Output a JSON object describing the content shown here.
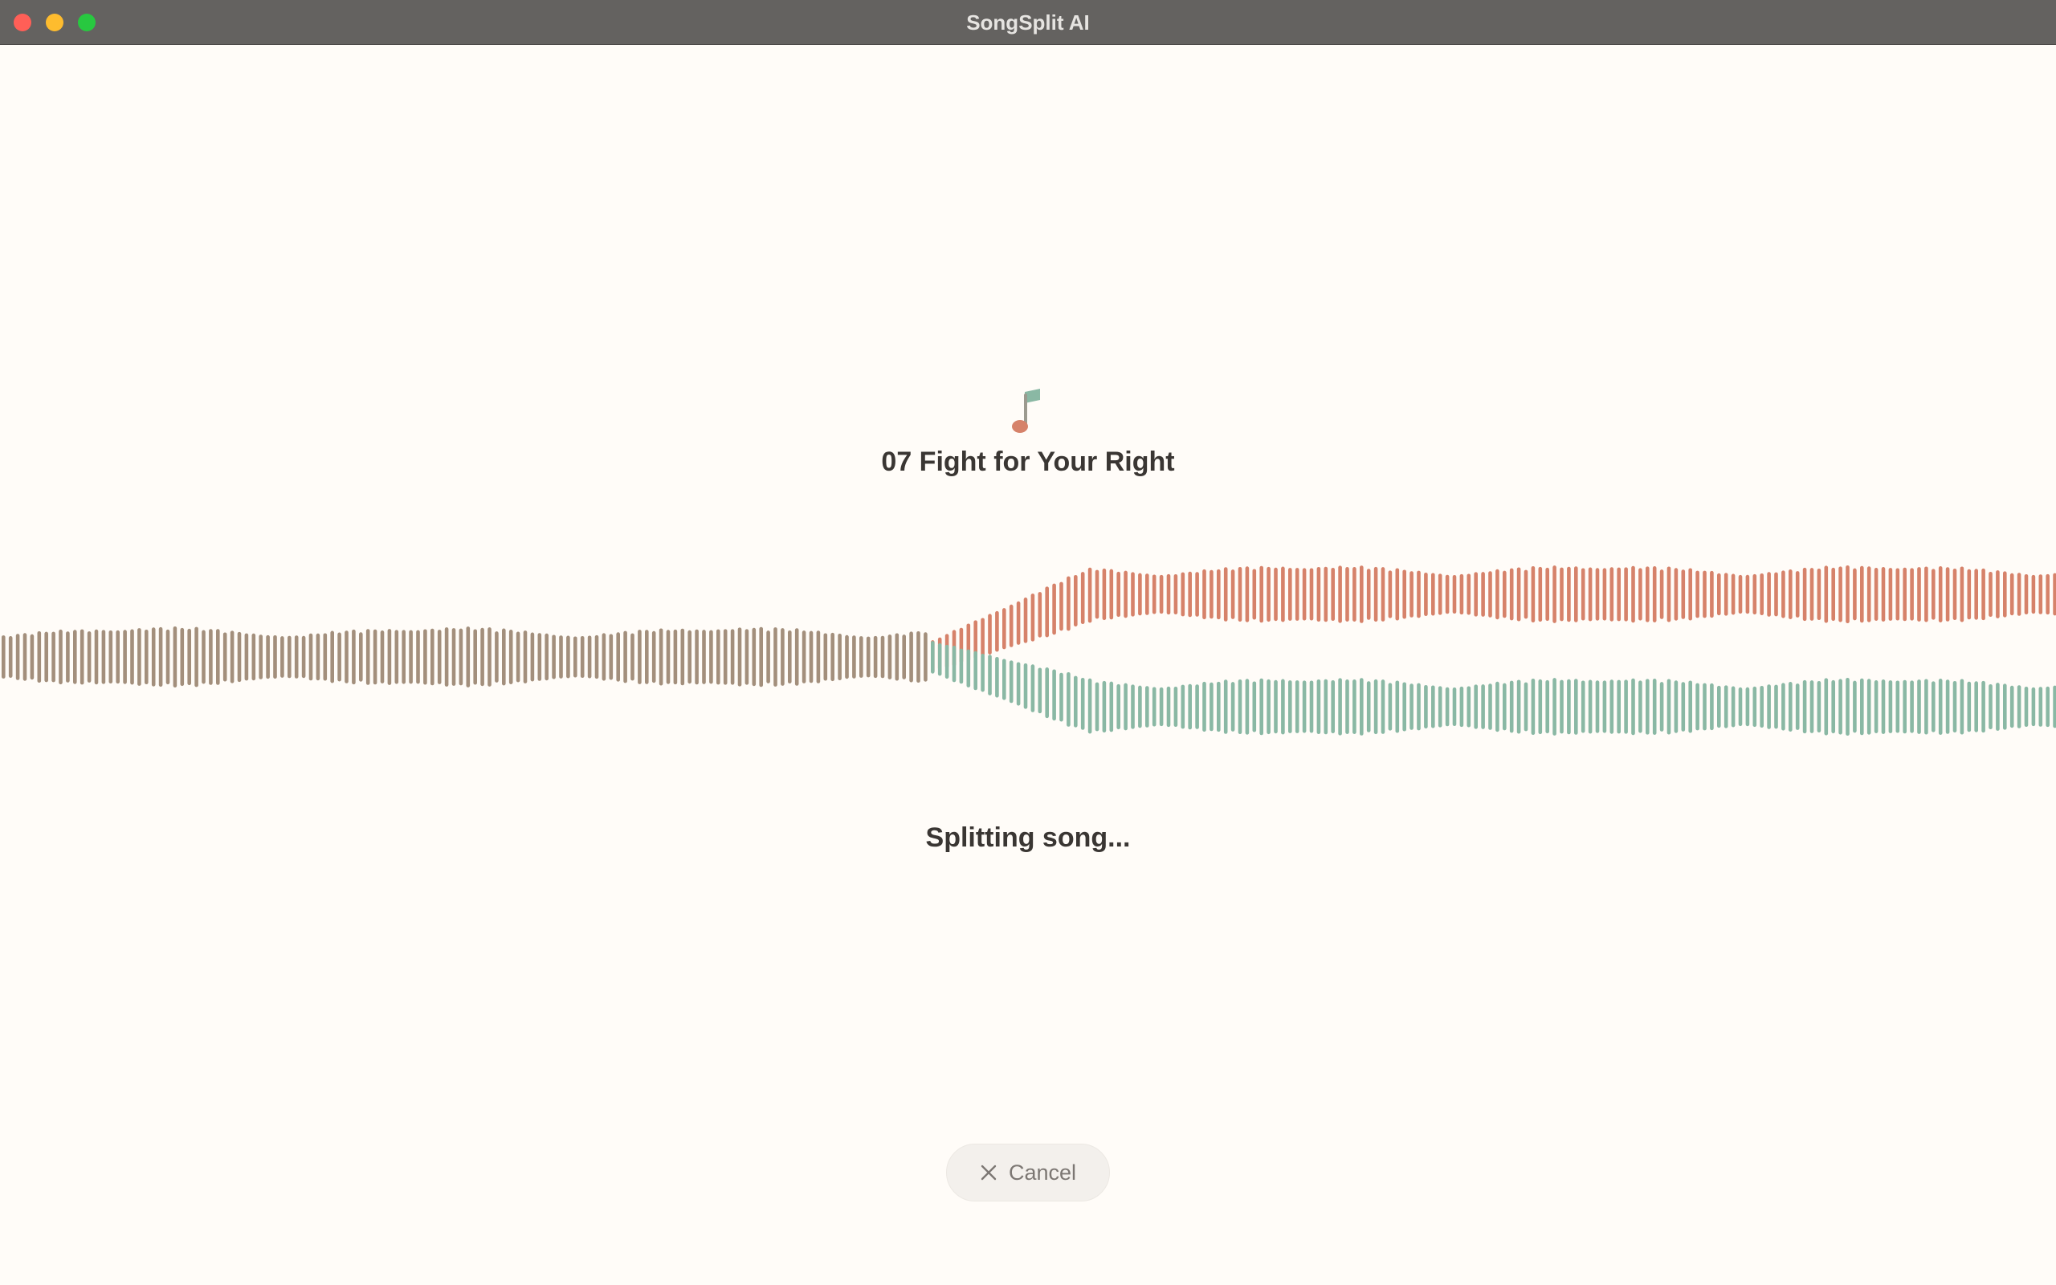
{
  "window": {
    "title": "SongSplit AI",
    "traffic_lights": {
      "close": "#ff5f57",
      "minimize": "#febc2e",
      "maximize": "#28c840"
    }
  },
  "song": {
    "title": "07 Fight for Your Right",
    "icon": "music-note-icon"
  },
  "status": {
    "text": "Splitting song..."
  },
  "cancel": {
    "label": "Cancel",
    "icon": "close-icon"
  },
  "colors": {
    "background": "#fffcf8",
    "mixed_wave": "#a38f7c",
    "vocals_wave": "#d6826a",
    "instrumental_wave": "#8ab8a4",
    "note_head": "#d6826a",
    "note_flag": "#8ab8a4"
  },
  "waveform": {
    "state": "splitting",
    "split_progress": 0.46
  }
}
